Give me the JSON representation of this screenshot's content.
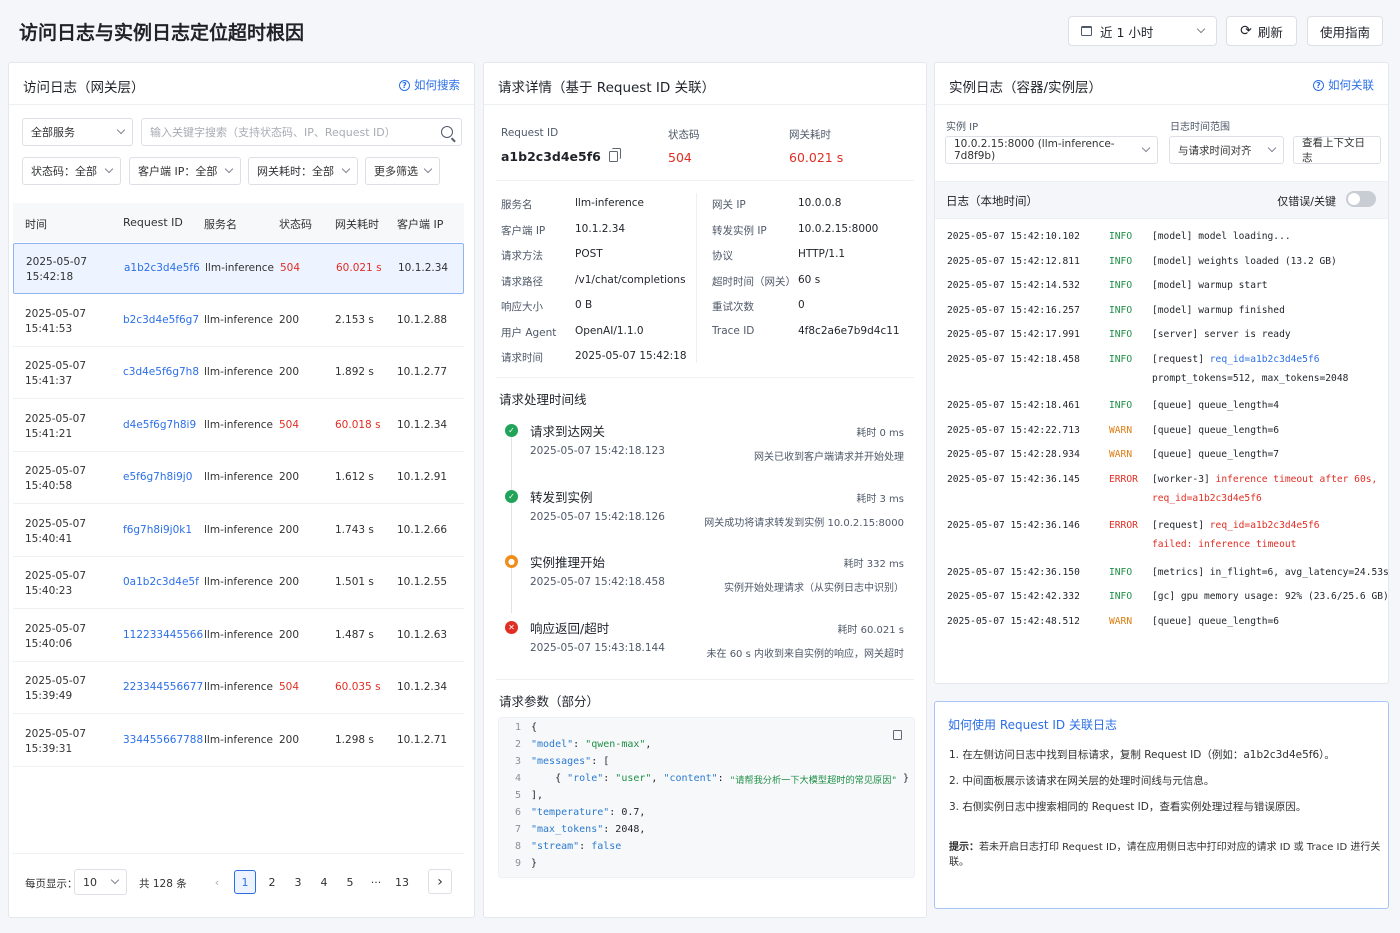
{
  "header": {
    "title": "访问日志与实例日志定位超时根因",
    "range": "近 1 小时",
    "refresh": "刷新",
    "guide": "使用指南"
  },
  "left": {
    "title": "访问日志（网关层）",
    "help": "如何搜索",
    "service_filter": "全部服务",
    "search_placeholder": "输入关键字搜索（支持状态码、IP、Request ID）",
    "filters": [
      "状态码：全部",
      "客户端 IP：全部",
      "网关耗时：全部",
      "更多筛选"
    ],
    "columns": [
      "时间",
      "Request ID",
      "服务名",
      "状态码",
      "网关耗时",
      "客户端 IP"
    ],
    "rows": [
      {
        "time": "2025-05-07 15:42:18",
        "rid": "a1b2c3d4e5f6",
        "svc": "llm-inference",
        "code": "504",
        "lat": "60.021 s",
        "ip": "10.1.2.34"
      },
      {
        "time": "2025-05-07 15:41:53",
        "rid": "b2c3d4e5f6g7",
        "svc": "llm-inference",
        "code": "200",
        "lat": "2.153 s",
        "ip": "10.1.2.88"
      },
      {
        "time": "2025-05-07 15:41:37",
        "rid": "c3d4e5f6g7h8",
        "svc": "llm-inference",
        "code": "200",
        "lat": "1.892 s",
        "ip": "10.1.2.77"
      },
      {
        "time": "2025-05-07 15:41:21",
        "rid": "d4e5f6g7h8i9",
        "svc": "llm-inference",
        "code": "504",
        "lat": "60.018 s",
        "ip": "10.1.2.34"
      },
      {
        "time": "2025-05-07 15:40:58",
        "rid": "e5f6g7h8i9j0",
        "svc": "llm-inference",
        "code": "200",
        "lat": "1.612 s",
        "ip": "10.1.2.91"
      },
      {
        "time": "2025-05-07 15:40:41",
        "rid": "f6g7h8i9j0k1",
        "svc": "llm-inference",
        "code": "200",
        "lat": "1.743 s",
        "ip": "10.1.2.66"
      },
      {
        "time": "2025-05-07 15:40:23",
        "rid": "0a1b2c3d4e5f",
        "svc": "llm-inference",
        "code": "200",
        "lat": "1.501 s",
        "ip": "10.1.2.55"
      },
      {
        "time": "2025-05-07 15:40:06",
        "rid": "112233445566",
        "svc": "llm-inference",
        "code": "200",
        "lat": "1.487 s",
        "ip": "10.1.2.63"
      },
      {
        "time": "2025-05-07 15:39:49",
        "rid": "223344556677",
        "svc": "llm-inference",
        "code": "504",
        "lat": "60.035 s",
        "ip": "10.1.2.34"
      },
      {
        "time": "2025-05-07 15:39:31",
        "rid": "334455667788",
        "svc": "llm-inference",
        "code": "200",
        "lat": "1.298 s",
        "ip": "10.1.2.71"
      }
    ],
    "page_size_label": "每页显示：",
    "page_size": "10",
    "total": "共 128 条",
    "pages": [
      "1",
      "2",
      "3",
      "4",
      "5",
      "···",
      "13"
    ]
  },
  "mid": {
    "title": "请求详情（基于 Request ID 关联）",
    "rid_label": "Request ID",
    "rid": "a1b2c3d4e5f6",
    "status_label": "状态码",
    "status": "504",
    "lat_label": "网关耗时",
    "lat": "60.021 s",
    "kv_left": [
      [
        "服务名",
        "llm-inference"
      ],
      [
        "客户端 IP",
        "10.1.2.34"
      ],
      [
        "请求方法",
        "POST"
      ],
      [
        "请求路径",
        "/v1/chat/completions"
      ],
      [
        "响应大小",
        "0 B"
      ],
      [
        "用户 Agent",
        "OpenAI/1.1.0"
      ],
      [
        "请求时间",
        "2025-05-07 15:42:18"
      ]
    ],
    "kv_right": [
      [
        "网关 IP",
        "10.0.0.8"
      ],
      [
        "转发实例 IP",
        "10.0.2.15:8000"
      ],
      [
        "协议",
        "HTTP/1.1"
      ],
      [
        "超时时间（网关）",
        "60 s"
      ],
      [
        "重试次数",
        "0"
      ],
      [
        "Trace ID",
        "4f8c2a6e7b9d4c11"
      ]
    ],
    "timeline_title": "请求处理时间线",
    "timeline": [
      {
        "title": "请求到达网关",
        "time": "2025-05-07 15:42:18.123",
        "cost": "耗时 0 ms",
        "desc": "网关已收到客户端请求并开始处理"
      },
      {
        "title": "转发到实例",
        "time": "2025-05-07 15:42:18.126",
        "cost": "耗时 3 ms",
        "desc": "网关成功将请求转发到实例 10.0.2.15:8000"
      },
      {
        "title": "实例推理开始",
        "time": "2025-05-07 15:42:18.458",
        "cost": "耗时 332 ms",
        "desc": "实例开始处理请求（从实例日志中识别）"
      },
      {
        "title": "响应返回/超时",
        "time": "2025-05-07 15:43:18.144",
        "cost": "耗时 60.021 s",
        "desc": "未在 60 s 内收到来自实例的响应，网关超时"
      }
    ],
    "params_title": "请求参数（部分）",
    "code": {
      "l1": "{",
      "k_model": "\"model\"",
      "v_model": "\"qwen-max\"",
      "k_messages": "\"messages\"",
      "k_role": "\"role\"",
      "v_role": "\"user\"",
      "k_content": "\"content\"",
      "v_content": "\"请帮我分析一下大模型超时的常见原因\"",
      "l5": "],",
      "k_temp": "\"temperature\"",
      "v_temp": "0.7",
      "k_max": "\"max_tokens\"",
      "v_max": "2048",
      "k_stream": "\"stream\"",
      "v_stream": "false",
      "l9": "}"
    }
  },
  "right": {
    "title": "实例日志（容器/实例层）",
    "help": "如何关联",
    "ip_label": "实例 IP",
    "ip_value": "10.0.2.15:8000 (llm-inference-7d8f9b)",
    "range_label": "日志时间范围",
    "range_value": "与请求时间对齐",
    "context_btn": "查看上下文日志",
    "log_title": "日志（本地时间）",
    "toggle_label": "仅错误/关键",
    "logs": [
      {
        "ts": "2025-05-07 15:42:10.102",
        "lv": "INFO",
        "msg": "[model] model loading..."
      },
      {
        "ts": "2025-05-07 15:42:12.811",
        "lv": "INFO",
        "msg": "[model] weights loaded (13.2 GB)"
      },
      {
        "ts": "2025-05-07 15:42:14.532",
        "lv": "INFO",
        "msg": "[model] warmup start"
      },
      {
        "ts": "2025-05-07 15:42:16.257",
        "lv": "INFO",
        "msg": "[model] warmup finished"
      },
      {
        "ts": "2025-05-07 15:42:17.991",
        "lv": "INFO",
        "msg": "[server] server is ready"
      },
      {
        "ts": "2025-05-07 15:42:18.458",
        "lv": "INFO",
        "msg": "[request] ",
        "msg_hl": "req_id=a1b2c3d4e5f6",
        "msg2": "prompt_tokens=512, max_tokens=2048"
      },
      {
        "ts": "2025-05-07 15:42:18.461",
        "lv": "INFO",
        "msg": "[queue] queue_length=4"
      },
      {
        "ts": "2025-05-07 15:42:22.713",
        "lv": "WARN",
        "msg": "[queue] queue_length=6"
      },
      {
        "ts": "2025-05-07 15:42:28.934",
        "lv": "WARN",
        "msg": "[queue] queue_length=7"
      },
      {
        "ts": "2025-05-07 15:42:36.145",
        "lv": "ERROR",
        "msg": "[worker-3] ",
        "msg_hl": "inference timeout after 60s,",
        "msg2": "req_id=a1b2c3d4e5f6"
      },
      {
        "ts": "2025-05-07 15:42:36.146",
        "lv": "ERROR",
        "msg": "[request] ",
        "msg_hl": "req_id=a1b2c3d4e5f6",
        "msg2": "failed: inference timeout"
      },
      {
        "ts": "2025-05-07 15:42:36.150",
        "lv": "INFO",
        "msg": "[metrics] in_flight=6, avg_latency=24.53s"
      },
      {
        "ts": "2025-05-07 15:42:42.332",
        "lv": "INFO",
        "msg": "[gc] gpu memory usage: 92% (23.6/25.6 GB)"
      },
      {
        "ts": "2025-05-07 15:42:48.512",
        "lv": "WARN",
        "msg": "[queue] queue_length=6"
      }
    ],
    "help_title": "如何使用 Request ID 关联日志",
    "help_items": [
      "1. 在左侧访问日志中找到目标请求，复制 Request ID（例如：a1b2c3d4e5f6）。",
      "2. 中间面板展示该请求在网关层的处理时间线与元信息。",
      "3. 右侧实例日志中搜索相同的 Request ID，查看实例处理过程与错误原因。"
    ],
    "help_tip_label": "提示：",
    "help_tip": "若未开启日志打印 Request ID，请在应用侧日志中打印对应的请求 ID 或 Trace ID 进行关联。"
  }
}
